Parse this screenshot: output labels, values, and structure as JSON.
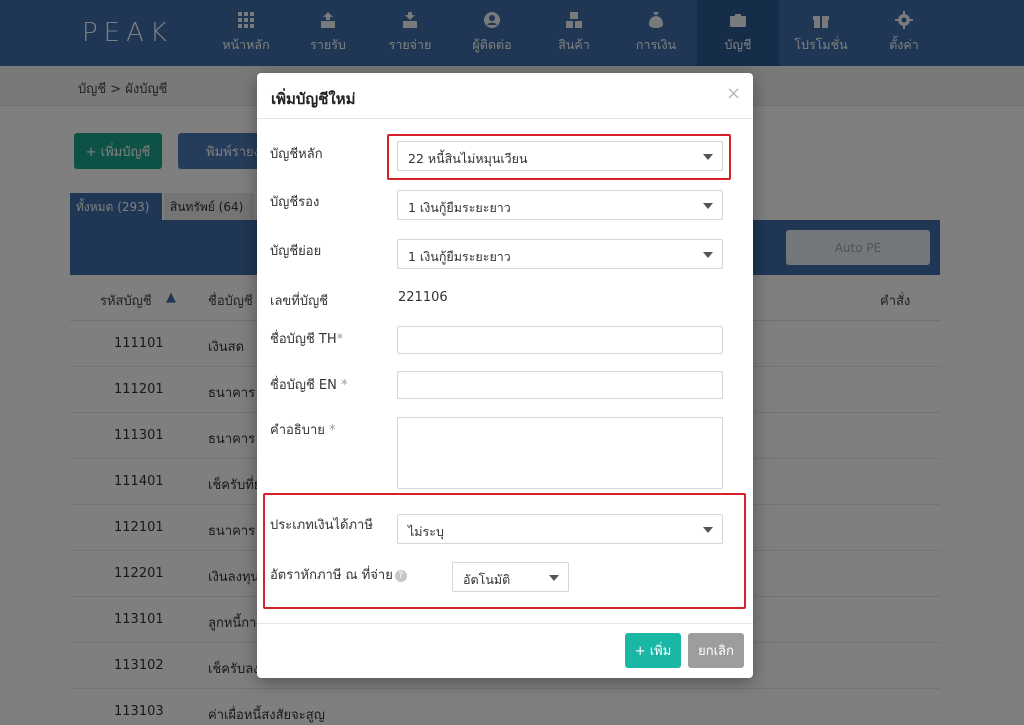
{
  "nav": {
    "logo": "PEAK",
    "items": [
      {
        "label": "หน้าหลัก",
        "icon": "grid-icon"
      },
      {
        "label": "รายรับ",
        "icon": "income-icon"
      },
      {
        "label": "รายจ่าย",
        "icon": "expense-icon"
      },
      {
        "label": "ผู้ติดต่อ",
        "icon": "contact-icon"
      },
      {
        "label": "สินค้า",
        "icon": "product-icon"
      },
      {
        "label": "การเงิน",
        "icon": "money-bag-icon"
      },
      {
        "label": "บัญชี",
        "icon": "briefcase-icon"
      },
      {
        "label": "โปรโมชั่น",
        "icon": "gift-icon"
      },
      {
        "label": "ตั้งค่า",
        "icon": "gear-icon"
      }
    ],
    "active_index": 6
  },
  "breadcrumb": "บัญชี > ผังบัญชี",
  "background": {
    "add_button": "+ เพิ่มบัญชี",
    "print_button": "พิมพ์รายงาน",
    "tabs": [
      {
        "label": "ทั้งหมด (293)"
      },
      {
        "label": "สินทรัพย์ (64)"
      }
    ],
    "panel_button": "Auto PE",
    "columns": {
      "code": "รหัสบัญชี",
      "name": "ชื่อบัญชี",
      "action": "คำสั่ง"
    },
    "rows": [
      {
        "code": "111101",
        "name": "เงินสด"
      },
      {
        "code": "111201",
        "name": "ธนาคาร"
      },
      {
        "code": "111301",
        "name": "ธนาคาร"
      },
      {
        "code": "111401",
        "name": "เช็ครับที่ย"
      },
      {
        "code": "112101",
        "name": "ธนาคาร"
      },
      {
        "code": "112201",
        "name": "เงินลงทุน"
      },
      {
        "code": "113101",
        "name": "ลูกหนี้กา"
      },
      {
        "code": "113102",
        "name": "เช็ครับลง"
      },
      {
        "code": "113103",
        "name": "ค่าเผื่อหนี้สงสัยจะสูญ"
      }
    ]
  },
  "modal": {
    "title": "เพิ่มบัญชีใหม่",
    "close": "×",
    "main_account_label": "บัญชีหลัก",
    "main_account_value": "22 หนี้สินไม่หมุนเวียน",
    "sub_account_label": "บัญชีรอง",
    "sub_account_value": "1 เงินกู้ยืมระยะยาว",
    "child_account_label": "บัญชีย่อย",
    "child_account_value": "1 เงินกู้ยืมระยะยาว",
    "account_no_label": "เลขที่บัญชี",
    "account_no_value": "221106",
    "name_th_label": "ชื่อบัญชี TH",
    "name_en_label": "ชื่อบัญชี EN",
    "description_label": "คำอธิบาย",
    "required_mark": "*",
    "income_type_label": "ประเภทเงินได้ภาษี",
    "income_type_value": "ไม่ระบุ",
    "wht_label": "อัตราหักภาษี ณ ที่จ่าย",
    "wht_help": "?",
    "wht_value": "อัตโนมัติ",
    "add_button": "+ เพิ่ม",
    "cancel_button": "ยกเลิก"
  },
  "colors": {
    "nav": "#3f6fa8",
    "nav_active": "#2d5b94",
    "accent": "#1bb7a6",
    "highlight": "#d6202a"
  }
}
